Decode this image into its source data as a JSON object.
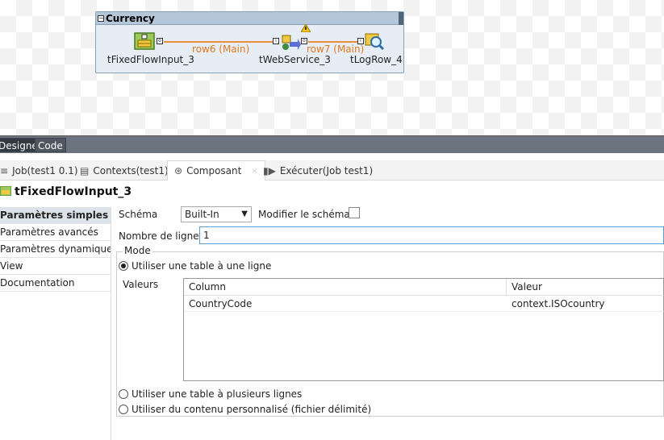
{
  "canvas": {
    "subjob_title": "Currency",
    "components": [
      {
        "label": "tFixedFlowInput_3"
      },
      {
        "label": "tWebService_3"
      },
      {
        "label": "tLogRow_4"
      }
    ],
    "connections": [
      {
        "label": "row6 (Main)"
      },
      {
        "label": "row7 (Main)"
      }
    ]
  },
  "designer_tabs": [
    "Designer",
    "Code"
  ],
  "view_tabs": [
    {
      "label": "Job(test1 0.1)",
      "icon": "job-icon"
    },
    {
      "label": "Contexts(test1)",
      "icon": "contexts-icon"
    },
    {
      "label": "Composant",
      "icon": "component-icon"
    },
    {
      "label": "Exécuter(Job test1)",
      "icon": "run-icon"
    }
  ],
  "component_title": "tFixedFlowInput_3",
  "nav": {
    "items": [
      {
        "label": "Paramètres simples"
      },
      {
        "label": "Paramètres avancés"
      },
      {
        "label": "Paramètres dynamiques"
      },
      {
        "label": "View"
      },
      {
        "label": "Documentation"
      }
    ]
  },
  "settings": {
    "schema_label": "Schéma",
    "schema_value": "Built-In",
    "modify_schema_label": "Modifier le schéma",
    "rows_label": "Nombre de lignes",
    "rows_value": "1",
    "mode_legend": "Mode",
    "radio_single": "Utiliser une table à une ligne",
    "values_label": "Valeurs",
    "table": {
      "columns": [
        "Column",
        "Valeur"
      ],
      "rows": [
        [
          "CountryCode",
          "context.ISOcountry"
        ]
      ]
    },
    "radio_multi": "Utiliser une table à plusieurs lignes",
    "radio_custom": "Utiliser du contenu personnalisé (fichier délimité)"
  }
}
